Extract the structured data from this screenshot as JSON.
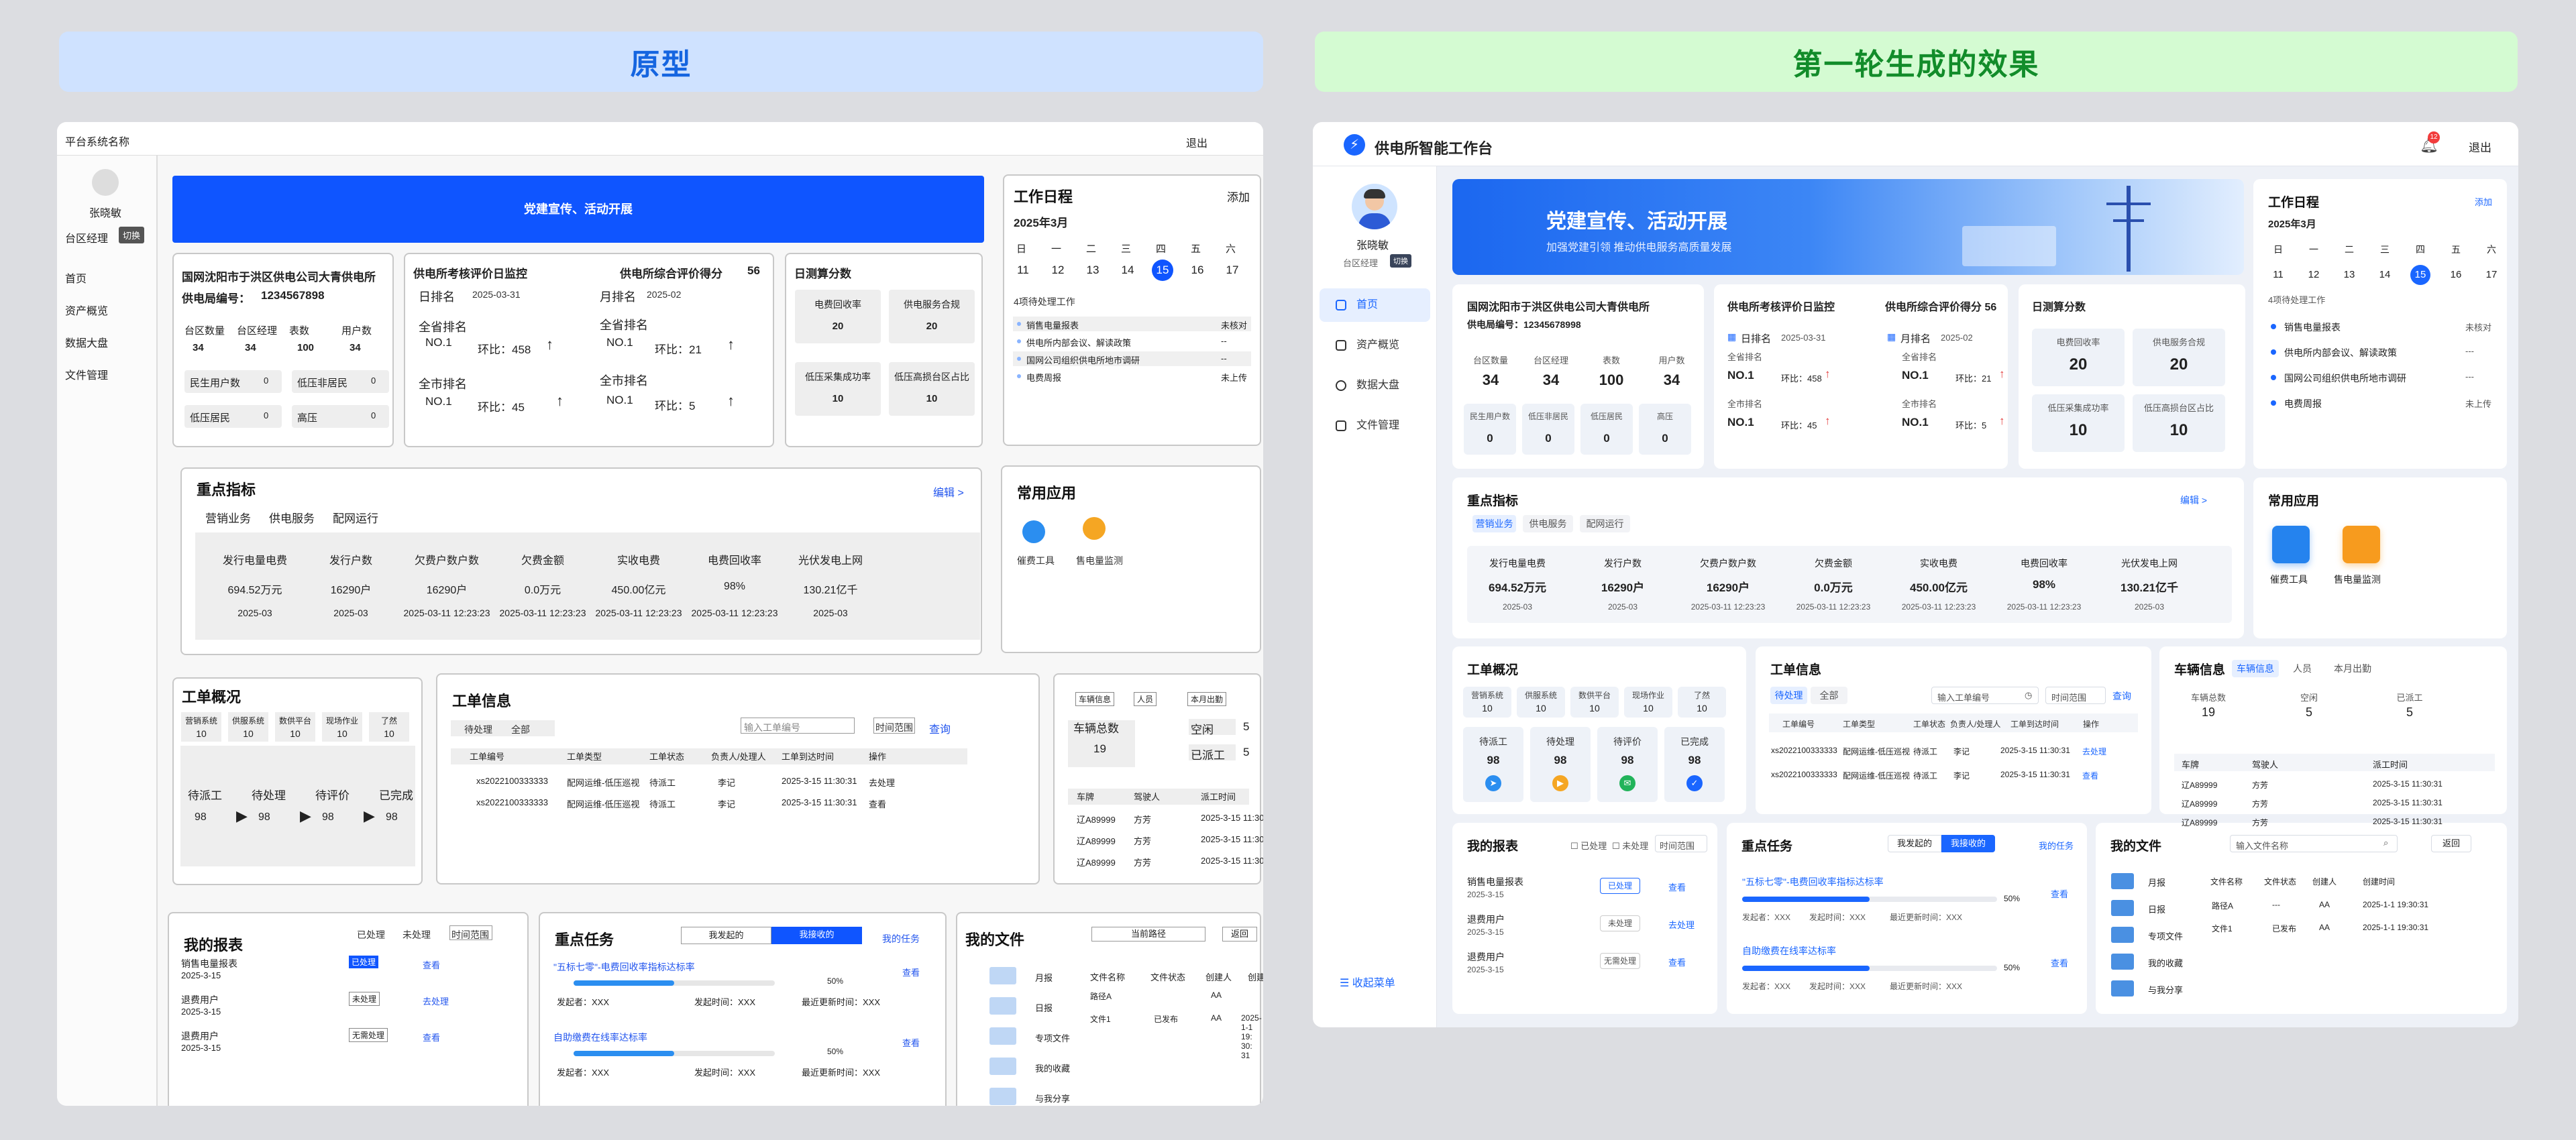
{
  "banners": {
    "left": "原型",
    "right": "第一轮生成的效果"
  },
  "proto": {
    "app_name": "平台系统名称",
    "logout": "退出",
    "user": "张晓敏",
    "role": "台区经理",
    "switch": "切换",
    "menu": [
      "首页",
      "资产概览",
      "数据大盘",
      "文件管理"
    ],
    "hero": "党建宣传、活动开展",
    "company": {
      "name": "国网沈阳市于洪区供电公司大青供电所",
      "code_label": "供电局编号：",
      "code": "1234567898",
      "stats": [
        {
          "label": "台区数量",
          "value": "34"
        },
        {
          "label": "台区经理",
          "value": "34"
        },
        {
          "label": "表数",
          "value": "100"
        },
        {
          "label": "用户数",
          "value": "34"
        }
      ],
      "sub": [
        {
          "label": "民生用户数",
          "value": "0"
        },
        {
          "label": "低压非居民",
          "value": "0"
        },
        {
          "label": "低压居民",
          "value": "0"
        },
        {
          "label": "高压",
          "value": "0"
        }
      ]
    },
    "eval": {
      "title": "供电所考核评价日监控",
      "score_label": "供电所综合评价得分",
      "score": "56",
      "daily": "日排名",
      "daily_date": "2025-03-31",
      "monthly": "月排名",
      "monthly_date": "2025-02",
      "prov": "全省排名",
      "city": "全市排名",
      "items": [
        {
          "rank": "NO.1",
          "ratio": "环比：458"
        },
        {
          "rank": "NO.1",
          "ratio": "环比：21"
        },
        {
          "rank": "NO.1",
          "ratio": "环比：45"
        },
        {
          "rank": "NO.1",
          "ratio": "环比：5"
        }
      ]
    },
    "daycalc": {
      "title": "日测算分数",
      "items": [
        {
          "label": "电费回收率",
          "value": "20"
        },
        {
          "label": "供电服务合规",
          "value": "20"
        },
        {
          "label": "低压采集成功率",
          "value": "10"
        },
        {
          "label": "低压高损台区占比",
          "value": "10"
        }
      ]
    },
    "schedule": {
      "title": "工作日程",
      "add": "添加",
      "month": "2025年3月",
      "weekdays": [
        "日",
        "一",
        "二",
        "三",
        "四",
        "五",
        "六"
      ],
      "days": [
        "11",
        "12",
        "13",
        "14",
        "15",
        "16",
        "17"
      ],
      "pending": "4项待处理工作",
      "tasks": [
        {
          "name": "销售电量报表",
          "status": "未核对"
        },
        {
          "name": "供电所内部会议、解读政策",
          "status": "--"
        },
        {
          "name": "国网公司组织供电所地市调研",
          "status": "--"
        },
        {
          "name": "电费周报",
          "status": "未上传"
        }
      ]
    },
    "key": {
      "title": "重点指标",
      "edit": "编辑  >",
      "tabs": [
        "营销业务",
        "供电服务",
        "配网运行"
      ],
      "cols": [
        {
          "label": "发行电量电费",
          "value": "694.52万元",
          "date": "2025-03"
        },
        {
          "label": "发行户数",
          "value": "16290户",
          "date": "2025-03"
        },
        {
          "label": "欠费户数户数",
          "value": "16290户",
          "date": "2025-03-11 12:23:23"
        },
        {
          "label": "欠费金额",
          "value": "0.0万元",
          "date": "2025-03-11 12:23:23"
        },
        {
          "label": "实收电费",
          "value": "450.00亿元",
          "date": "2025-03-11 12:23:23"
        },
        {
          "label": "电费回收率",
          "value": "98%",
          "date": "2025-03-11 12:23:23"
        },
        {
          "label": "光伏发电上网",
          "value": "130.21亿千",
          "date": "2025-03"
        }
      ]
    },
    "apps": {
      "title": "常用应用",
      "items": [
        "催费工具",
        "售电量监测"
      ]
    },
    "orders": {
      "title": "工单概况",
      "sys": [
        {
          "label": "营销系统",
          "value": "10"
        },
        {
          "label": "供服系统",
          "value": "10"
        },
        {
          "label": "数供平台",
          "value": "10"
        },
        {
          "label": "现场作业",
          "value": "10"
        },
        {
          "label": "了然",
          "value": "10"
        }
      ],
      "flow": [
        {
          "label": "待派工",
          "value": "98"
        },
        {
          "label": "待处理",
          "value": "98"
        },
        {
          "label": "待评价",
          "value": "98"
        },
        {
          "label": "已完成",
          "value": "98"
        }
      ]
    },
    "info": {
      "title": "工单信息",
      "tabs": [
        "待处理",
        "全部"
      ],
      "search": "输入工单编号",
      "time": "时间范围",
      "query": "查询",
      "cols": [
        "工单编号",
        "工单类型",
        "工单状态",
        "负责人/处理人",
        "工单到达时间",
        "操作"
      ],
      "rows": [
        [
          "xs2022100333333",
          "配网运维-低压巡视",
          "待派工",
          "李记",
          "2025-3-15  11:30:31",
          "去处理"
        ],
        [
          "xs2022100333333",
          "配网运维-低压巡视",
          "待派工",
          "李记",
          "2025-3-15  11:30:31",
          "查看"
        ]
      ]
    },
    "vehicle": {
      "tabs": [
        "车辆信息",
        "人员",
        "本月出勤"
      ],
      "total_label": "车辆总数",
      "total": "19",
      "idle_label": "空闲",
      "idle": "5",
      "out_label": "已派工",
      "out": "5",
      "cols": [
        "车牌",
        "驾驶人",
        "派工时间"
      ],
      "rows": [
        [
          "辽A89999",
          "方芳",
          "2025-3-15  11:30:31"
        ],
        [
          "辽A89999",
          "方芳",
          "2025-3-15  11:30:31"
        ],
        [
          "辽A89999",
          "方芳",
          "2025-3-15  11:30:31"
        ]
      ]
    },
    "report": {
      "title": "我的报表",
      "chk1": "已处理",
      "chk2": "未处理",
      "time": "时间范围",
      "rows": [
        {
          "name": "销售电量报表",
          "date": "2025-3-15",
          "status": "已处理",
          "op": "查看"
        },
        {
          "name": "退费用户",
          "date": "2025-3-15",
          "status": "未处理",
          "op": "去处理"
        },
        {
          "name": "退费用户",
          "date": "2025-3-15",
          "status": "无需处理",
          "op": "查看"
        }
      ]
    },
    "keytask": {
      "title": "重点任务",
      "tab1": "我发起的",
      "tab2": "我接收的",
      "mine": "我的任务",
      "rows": [
        {
          "name": "\"五标七零\"-电费回收率指标达标率",
          "pct": "50%",
          "op": "查看",
          "pct_value": 0.5,
          "starter": "发起者：XXX",
          "start": "发起时间：XXX",
          "update": "最近更新时间：XXX"
        },
        {
          "name": "自助缴费在线率达标率",
          "pct": "50%",
          "op": "查看",
          "pct_value": 0.5,
          "starter": "发起者：XXX",
          "start": "发起时间：XXX",
          "update": "最近更新时间：XXX"
        }
      ]
    },
    "files": {
      "title": "我的文件",
      "path": "当前路径",
      "back": "返回",
      "folders": [
        "月报",
        "日报",
        "专项文件",
        "我的收藏",
        "与我分享"
      ],
      "cols": [
        "文件名称",
        "文件状态",
        "创建人",
        "创建时间"
      ],
      "rows": [
        [
          "路径A",
          "",
          "AA",
          ""
        ],
        [
          "文件1",
          "已发布",
          "AA",
          "2025-1-1 19: 30: 31"
        ]
      ]
    }
  },
  "gen": {
    "app_name": "供电所智能工作台",
    "logout": "退出",
    "badge": "12",
    "user": "张晓敏",
    "role": "台区经理",
    "switch": "切换",
    "menu": [
      "首页",
      "资产概览",
      "数据大盘",
      "文件管理"
    ],
    "collapse": "收起菜单",
    "hero_title": "党建宣传、活动开展",
    "hero_sub": "加强党建引领  推动供电服务高质量发展",
    "company": {
      "name": "国网沈阳市于洪区供电公司大青供电所",
      "code": "供电局编号：12345678998",
      "stats": [
        {
          "label": "台区数量",
          "value": "34"
        },
        {
          "label": "台区经理",
          "value": "34"
        },
        {
          "label": "表数",
          "value": "100"
        },
        {
          "label": "用户数",
          "value": "34"
        }
      ],
      "sub": [
        {
          "label": "民生用户数",
          "value": "0"
        },
        {
          "label": "低压非居民",
          "value": "0"
        },
        {
          "label": "低压居民",
          "value": "0"
        },
        {
          "label": "高压",
          "value": "0"
        }
      ]
    },
    "eval": {
      "title": "供电所考核评价日监控",
      "score": "供电所综合评价得分  56",
      "daily": "日排名",
      "daily_date": "2025-03-31",
      "monthly": "月排名",
      "monthly_date": "2025-02",
      "prov": "全省排名",
      "city": "全市排名",
      "items": [
        {
          "rank": "NO.1",
          "ratio": "环比：458"
        },
        {
          "rank": "NO.1",
          "ratio": "环比：21"
        },
        {
          "rank": "NO.1",
          "ratio": "环比：45"
        },
        {
          "rank": "NO.1",
          "ratio": "环比：5"
        }
      ]
    },
    "daycalc": {
      "title": "日测算分数",
      "items": [
        {
          "label": "电费回收率",
          "value": "20"
        },
        {
          "label": "供电服务合规",
          "value": "20"
        },
        {
          "label": "低压采集成功率",
          "value": "10"
        },
        {
          "label": "低压高损台区占比",
          "value": "10"
        }
      ]
    },
    "schedule": {
      "title": "工作日程",
      "add": "添加",
      "month": "2025年3月",
      "pending": "4项待处理工作",
      "tasks": [
        {
          "name": "销售电量报表",
          "status": "未核对"
        },
        {
          "name": "供电所内部会议、解读政策",
          "status": "---"
        },
        {
          "name": "国网公司组织供电所地市调研",
          "status": "---"
        },
        {
          "name": "电费周报",
          "status": "未上传"
        }
      ]
    },
    "key": {
      "title": "重点指标",
      "edit": "编辑  >"
    },
    "apps": {
      "title": "常用应用"
    },
    "orders": {
      "title": "工单概况"
    },
    "info": {
      "title": "工单信息",
      "search": "输入工单编号",
      "time": "时间范围",
      "query": "查询",
      "rows": [
        [
          "xs2022100333333",
          "配网运维-低压巡视",
          "待派工",
          "李记",
          "2025-3-15 11:30:31",
          "去处理"
        ],
        [
          "xs2022100333333",
          "配网运维-低压巡视",
          "待派工",
          "李记",
          "2025-3-15 11:30:31",
          "查看"
        ]
      ]
    },
    "vehicle": {
      "title": "车辆信息",
      "total_label": "车辆总数",
      "total": "19",
      "idle_label": "空闲",
      "idle": "5",
      "out_label": "已派工",
      "out": "5",
      "rows": [
        [
          "辽A89999",
          "方芳",
          "2025-3-15 11:30:31"
        ],
        [
          "辽A89999",
          "方芳",
          "2025-3-15 11:30:31"
        ],
        [
          "辽A89999",
          "方芳",
          "2025-3-15 11:30:31"
        ]
      ]
    },
    "report": {
      "title": "我的报表",
      "chk1": "已处理",
      "chk2": "未处理",
      "time": "时间范围",
      "rows": [
        {
          "name": "销售电量报表",
          "date": "2025-3-15",
          "status": "已处理",
          "op": "查看"
        },
        {
          "name": "退费用户",
          "date": "2025-3-15",
          "status": "未处理",
          "op": "去处理"
        },
        {
          "name": "退费用户",
          "date": "2025-3-15",
          "status": "无需处理",
          "op": "查看"
        }
      ]
    },
    "keytask": {
      "title": "重点任务",
      "tab1": "我发起的",
      "tab2": "我接收的",
      "mine": "我的任务",
      "rows": [
        {
          "name": "\"五标七零\"-电费回收率指标达标率",
          "pct": "50%",
          "op": "查看",
          "pct_value": 0.5,
          "starter": "发起者：XXX",
          "start": "发起时间：XXX",
          "update": "最近更新时间：XXX"
        },
        {
          "name": "自助缴费在线率达标率",
          "pct": "50%",
          "op": "查看",
          "pct_value": 0.5,
          "starter": "发起者：XXX",
          "start": "发起时间：XXX",
          "update": "最近更新时间：XXX"
        }
      ]
    },
    "files": {
      "title": "我的文件",
      "search": "输入文件名称",
      "back": "返回",
      "folders": [
        "月报",
        "日报",
        "专项文件",
        "我的收藏",
        "与我分享"
      ],
      "cols": [
        "文件名称",
        "文件状态",
        "创建人",
        "创建时间"
      ],
      "rows": [
        [
          "路径A",
          "---",
          "AA",
          "2025-1-1 19:30:31"
        ],
        [
          "文件1",
          "已发布",
          "AA",
          "2025-1-1 19:30:31"
        ]
      ]
    }
  },
  "colors": {
    "accent": "#1a66ff",
    "hero": "#1565e0",
    "left_banner": "#cfe2ff",
    "right_banner": "#d4fbd2"
  }
}
